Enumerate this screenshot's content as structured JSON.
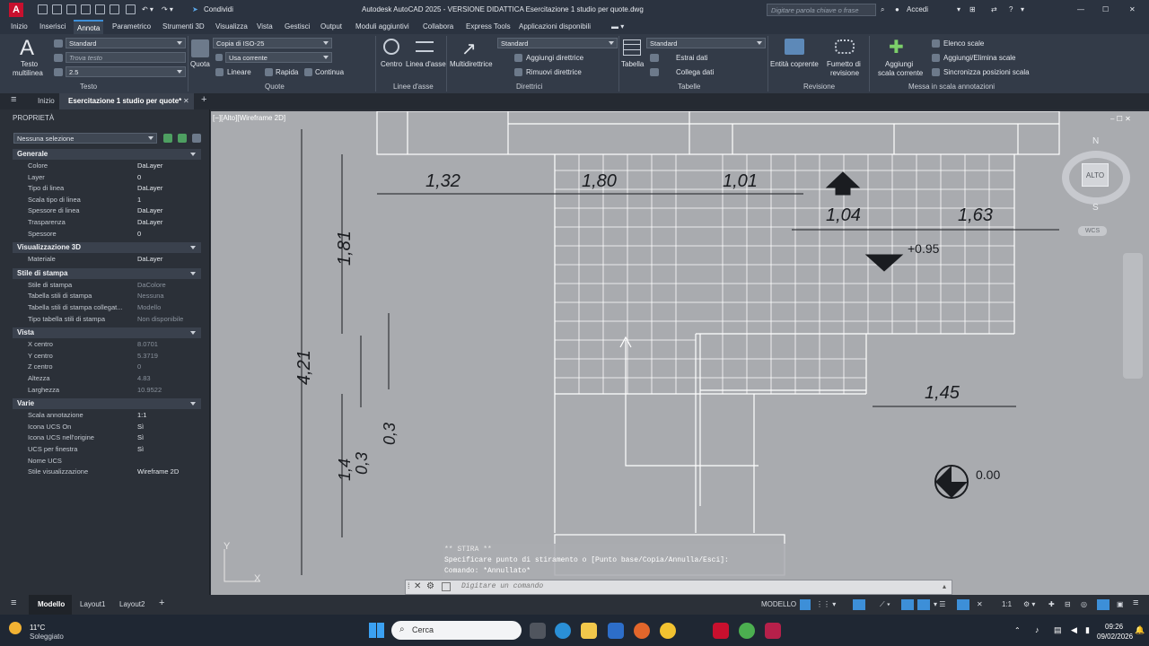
{
  "titlebar": {
    "share_label": "Condividi",
    "title": "Autodesk AutoCAD 2025 - VERSIONE DIDATTICA   Esercitazione 1 studio per quote.dwg",
    "search_placeholder": "Digitare parola chiave o frase",
    "signin_label": "Accedi"
  },
  "menu_tabs": [
    "Inizio",
    "Inserisci",
    "Annota",
    "Parametrico",
    "Strumenti 3D",
    "Visualizza",
    "Vista",
    "Gestisci",
    "Output",
    "Moduli aggiuntivi",
    "Collabora",
    "Express Tools",
    "Applicazioni disponibili"
  ],
  "active_tab": "Annota",
  "ribbon": {
    "testo": {
      "multiline_label_1": "Testo",
      "multiline_label_2": "multilinea",
      "style_value": "Standard",
      "find_placeholder": "Trova testo",
      "height_value": "2.5",
      "section_label": "Testo"
    },
    "quote": {
      "quota_label": "Quota",
      "dimstyle_value": "Copia di ISO-25",
      "layer_value": "Usa corrente",
      "lineare_label": "Lineare",
      "rapida_label": "Rapida",
      "continua_label": "Continua",
      "section_label": "Quote"
    },
    "linee_asse": {
      "centro_label": "Centro",
      "linea_asse_label": "Linea d'asse",
      "section_label": "Linee d'asse"
    },
    "direttrici": {
      "multidirettrice_label": "Multidirettrice",
      "style_value": "Standard",
      "add_label": "Aggiungi direttrice",
      "remove_label": "Rimuovi direttrice",
      "section_label": "Direttrici"
    },
    "tabelle": {
      "tabella_label": "Tabella",
      "style_value": "Standard",
      "extract_label": "Estrai dati",
      "link_label": "Collega dati",
      "section_label": "Tabelle"
    },
    "revisione": {
      "entita_label": "Entità coprente",
      "fumetto_label_1": "Fumetto di",
      "fumetto_label_2": "revisione",
      "section_label": "Revisione"
    },
    "scala": {
      "add_label_1": "Aggiungi",
      "add_label_2": "scala corrente",
      "elenco_label": "Elenco scale",
      "add_remove_label": "Aggiungi/Elimina scale",
      "sync_label": "Sincronizza posizioni scala",
      "section_label": "Messa in scala annotazioni"
    }
  },
  "doc_tabs": {
    "start": "Inizio",
    "active": "Esercitazione 1 studio per quote*"
  },
  "palette": {
    "title": "PROPRIETÀ",
    "selection": "Nessuna selezione",
    "sections": [
      {
        "name": "Generale",
        "rows": [
          {
            "k": "Colore",
            "v": "DaLayer"
          },
          {
            "k": "Layer",
            "v": "0"
          },
          {
            "k": "Tipo di linea",
            "v": "DaLayer"
          },
          {
            "k": "Scala tipo di linea",
            "v": "1"
          },
          {
            "k": "Spessore di linea",
            "v": "DaLayer"
          },
          {
            "k": "Trasparenza",
            "v": "DaLayer"
          },
          {
            "k": "Spessore",
            "v": "0"
          }
        ]
      },
      {
        "name": "Visualizzazione 3D",
        "rows": [
          {
            "k": "Materiale",
            "v": "DaLayer"
          }
        ]
      },
      {
        "name": "Stile di stampa",
        "rows": [
          {
            "k": "Stile di stampa",
            "v": "DaColore"
          },
          {
            "k": "Tabella stili di stampa",
            "v": "Nessuna"
          },
          {
            "k": "Tabella stili di stampa collegat...",
            "v": "Modello"
          },
          {
            "k": "Tipo tabella stili di stampa",
            "v": "Non disponibile"
          }
        ]
      },
      {
        "name": "Vista",
        "rows": [
          {
            "k": "X centro",
            "v": "8.0701"
          },
          {
            "k": "Y centro",
            "v": "5.3719"
          },
          {
            "k": "Z centro",
            "v": "0"
          },
          {
            "k": "Altezza",
            "v": "4.83"
          },
          {
            "k": "Larghezza",
            "v": "10.9522"
          }
        ]
      },
      {
        "name": "Varie",
        "rows": [
          {
            "k": "Scala annotazione",
            "v": "1:1"
          },
          {
            "k": "Icona UCS On",
            "v": "Sì"
          },
          {
            "k": "Icona UCS nell'origine",
            "v": "Sì"
          },
          {
            "k": "UCS per finestra",
            "v": "Sì"
          },
          {
            "k": "Nome UCS",
            "v": ""
          },
          {
            "k": "Stile visualizzazione",
            "v": "Wireframe 2D"
          }
        ]
      }
    ]
  },
  "viewport": {
    "label": "[−][Alto][Wireframe 2D]",
    "dims": {
      "d1": "1,32",
      "d2": "1,80",
      "d3": "1,01",
      "d4": "1,04",
      "d5": "1,63",
      "d6": "1,45",
      "v1": "1,81",
      "v2": "4,21",
      "v3": "0,3",
      "v4": "1,4",
      "v5": "0,3",
      "elev": "+0.95",
      "level": "0.00"
    },
    "viewcube": {
      "n": "N",
      "s": "S",
      "top": "ALTO",
      "wcs": "WCS"
    },
    "ucs": {
      "y": "Y",
      "x": "X"
    }
  },
  "command": {
    "line1": "** STIRA **",
    "line2": "Specificare punto di stiramento o [Punto base/Copia/Annulla/Esci]:",
    "line3": "Comando: *Annullato*",
    "placeholder": "Digitare un comando"
  },
  "status": {
    "model_tab": "Modello",
    "layout1": "Layout1",
    "layout2": "Layout2",
    "modello": "MODELLO",
    "scale": "1:1"
  },
  "taskbar": {
    "temp": "11°C",
    "weather": "Soleggiato",
    "search": "Cerca",
    "time": "09:26",
    "date": "09/02/2026"
  },
  "colors": {
    "accent": "#3d8fd8",
    "canvas": "#a9abaf",
    "brand": "#c8102e"
  }
}
